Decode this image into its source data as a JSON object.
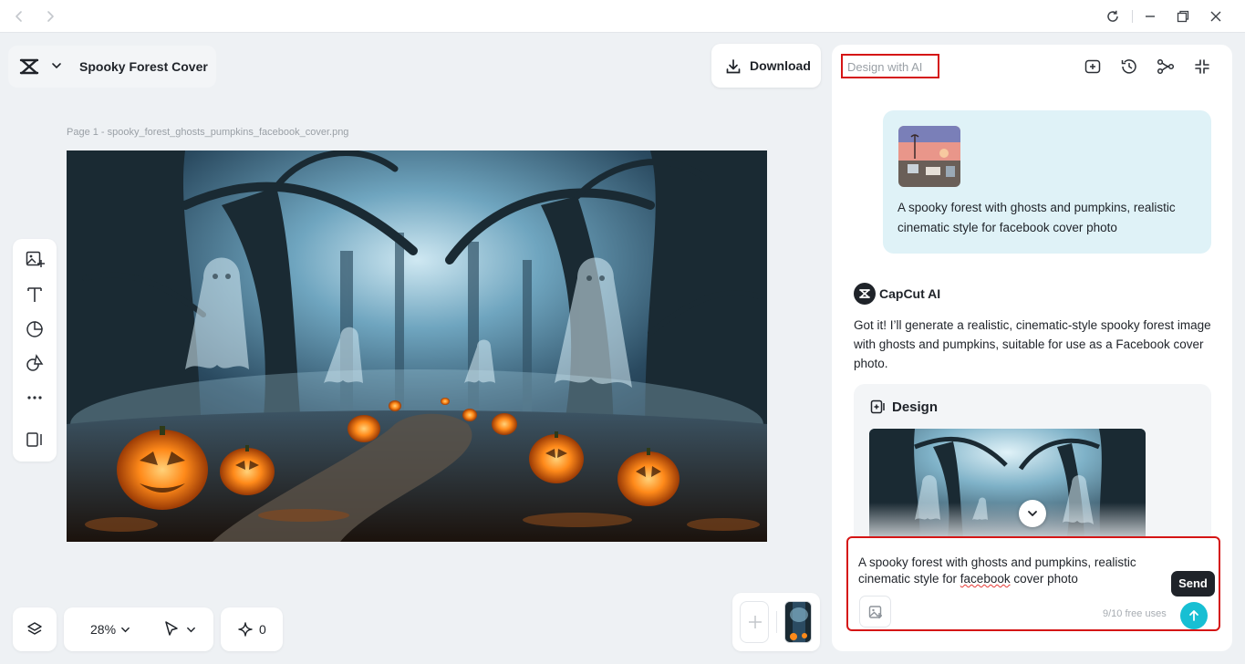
{
  "window": {
    "icons": {
      "back": "chevron-left-icon",
      "forward": "chevron-right-icon",
      "refresh": "refresh-icon",
      "minimize": "minimize-icon",
      "restore": "restore-icon",
      "close": "close-icon"
    }
  },
  "header": {
    "project_title": "Spooky Forest Cover",
    "download_label": "Download"
  },
  "canvas": {
    "page_label": "Page 1 -   spooky_forest_ghosts_pumpkins_facebook_cover.png"
  },
  "toolbar": {
    "tools": [
      "image-upload-icon",
      "text-icon",
      "element-icon",
      "shapes-icon",
      "more-icon",
      "side-panel-icon"
    ]
  },
  "bottom_bar": {
    "zoom": "28%",
    "ai_count": "0"
  },
  "panel": {
    "title": "Design with AI",
    "header_icons": [
      "new-chat-icon",
      "history-icon",
      "share-icon",
      "collapse-icon"
    ],
    "user_message": "A spooky forest with ghosts and pumpkins, realistic cinematic style for facebook cover photo",
    "ai_name": "CapCut AI",
    "ai_reply": "Got it! I’ll generate a realistic, cinematic-style spooky forest image with ghosts and pumpkins, suitable for use as a Facebook cover photo.",
    "design_label": "Design"
  },
  "input": {
    "text_before": "A spooky forest with ghosts and pumpkins, realistic cinematic style for ",
    "text_misspelled": "facebook",
    "text_after": " cover photo",
    "free_uses": "9/10 free uses",
    "send_tooltip": "Send"
  },
  "colors": {
    "accent": "#17bfd3",
    "highlight_border": "#d51515",
    "user_bubble": "#dff2f7",
    "app_background": "#eef1f4"
  }
}
